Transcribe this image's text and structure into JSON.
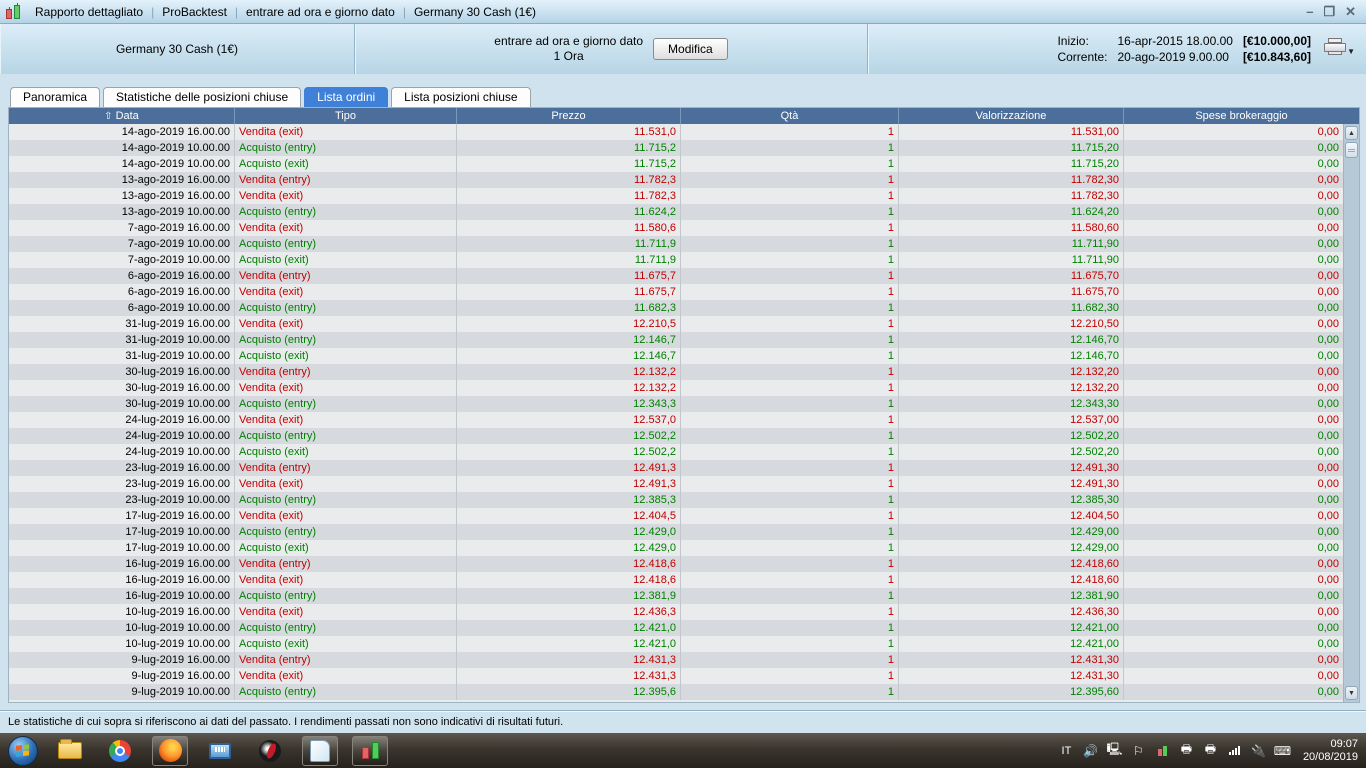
{
  "titlebar": {
    "segments": [
      "Rapporto dettagliato",
      "ProBacktest",
      "entrare ad ora e giorno dato",
      "Germany 30 Cash (1€)"
    ],
    "controls": {
      "minimize": "–",
      "restore": "❐",
      "close": "✕"
    }
  },
  "header": {
    "instrument": "Germany 30 Cash (1€)",
    "strategy": "entrare ad ora e giorno dato",
    "timeframe": "1 Ora",
    "modify_button": "Modifica",
    "start_label": "Inizio:",
    "start_date": "16-apr-2015 18.00.00",
    "start_amount": "[€10.000,00]",
    "current_label": "Corrente:",
    "current_date": "20-ago-2019 9.00.00",
    "current_amount": "[€10.843,60]"
  },
  "tabs": {
    "items": [
      {
        "label": "Panoramica",
        "active": false
      },
      {
        "label": "Statistiche delle posizioni chiuse",
        "active": false
      },
      {
        "label": "Lista ordini",
        "active": true
      },
      {
        "label": "Lista posizioni chiuse",
        "active": false
      }
    ]
  },
  "table": {
    "sort_arrow": "⇧",
    "columns": [
      "Data",
      "Tipo",
      "Prezzo",
      "Qtà",
      "Valorizzazione",
      "Spese brokeraggio"
    ],
    "colors": {
      "sell": "#c00000",
      "buy": "#008000",
      "header_bg": "#4b6f9a"
    },
    "rows": [
      {
        "date": "14-ago-2019 16.00.00",
        "type": "Vendita (exit)",
        "side": "sell",
        "price": "11.531,0",
        "qty": "1",
        "valuation": "11.531,00",
        "fees": "0,00"
      },
      {
        "date": "14-ago-2019 10.00.00",
        "type": "Acquisto (entry)",
        "side": "buy",
        "price": "11.715,2",
        "qty": "1",
        "valuation": "11.715,20",
        "fees": "0,00"
      },
      {
        "date": "14-ago-2019 10.00.00",
        "type": "Acquisto (exit)",
        "side": "buy",
        "price": "11.715,2",
        "qty": "1",
        "valuation": "11.715,20",
        "fees": "0,00"
      },
      {
        "date": "13-ago-2019 16.00.00",
        "type": "Vendita (entry)",
        "side": "sell",
        "price": "11.782,3",
        "qty": "1",
        "valuation": "11.782,30",
        "fees": "0,00"
      },
      {
        "date": "13-ago-2019 16.00.00",
        "type": "Vendita (exit)",
        "side": "sell",
        "price": "11.782,3",
        "qty": "1",
        "valuation": "11.782,30",
        "fees": "0,00"
      },
      {
        "date": "13-ago-2019 10.00.00",
        "type": "Acquisto (entry)",
        "side": "buy",
        "price": "11.624,2",
        "qty": "1",
        "valuation": "11.624,20",
        "fees": "0,00"
      },
      {
        "date": "7-ago-2019 16.00.00",
        "type": "Vendita (exit)",
        "side": "sell",
        "price": "11.580,6",
        "qty": "1",
        "valuation": "11.580,60",
        "fees": "0,00"
      },
      {
        "date": "7-ago-2019 10.00.00",
        "type": "Acquisto (entry)",
        "side": "buy",
        "price": "11.711,9",
        "qty": "1",
        "valuation": "11.711,90",
        "fees": "0,00"
      },
      {
        "date": "7-ago-2019 10.00.00",
        "type": "Acquisto (exit)",
        "side": "buy",
        "price": "11.711,9",
        "qty": "1",
        "valuation": "11.711,90",
        "fees": "0,00"
      },
      {
        "date": "6-ago-2019 16.00.00",
        "type": "Vendita (entry)",
        "side": "sell",
        "price": "11.675,7",
        "qty": "1",
        "valuation": "11.675,70",
        "fees": "0,00"
      },
      {
        "date": "6-ago-2019 16.00.00",
        "type": "Vendita (exit)",
        "side": "sell",
        "price": "11.675,7",
        "qty": "1",
        "valuation": "11.675,70",
        "fees": "0,00"
      },
      {
        "date": "6-ago-2019 10.00.00",
        "type": "Acquisto (entry)",
        "side": "buy",
        "price": "11.682,3",
        "qty": "1",
        "valuation": "11.682,30",
        "fees": "0,00"
      },
      {
        "date": "31-lug-2019 16.00.00",
        "type": "Vendita (exit)",
        "side": "sell",
        "price": "12.210,5",
        "qty": "1",
        "valuation": "12.210,50",
        "fees": "0,00"
      },
      {
        "date": "31-lug-2019 10.00.00",
        "type": "Acquisto (entry)",
        "side": "buy",
        "price": "12.146,7",
        "qty": "1",
        "valuation": "12.146,70",
        "fees": "0,00"
      },
      {
        "date": "31-lug-2019 10.00.00",
        "type": "Acquisto (exit)",
        "side": "buy",
        "price": "12.146,7",
        "qty": "1",
        "valuation": "12.146,70",
        "fees": "0,00"
      },
      {
        "date": "30-lug-2019 16.00.00",
        "type": "Vendita (entry)",
        "side": "sell",
        "price": "12.132,2",
        "qty": "1",
        "valuation": "12.132,20",
        "fees": "0,00"
      },
      {
        "date": "30-lug-2019 16.00.00",
        "type": "Vendita (exit)",
        "side": "sell",
        "price": "12.132,2",
        "qty": "1",
        "valuation": "12.132,20",
        "fees": "0,00"
      },
      {
        "date": "30-lug-2019 10.00.00",
        "type": "Acquisto (entry)",
        "side": "buy",
        "price": "12.343,3",
        "qty": "1",
        "valuation": "12.343,30",
        "fees": "0,00"
      },
      {
        "date": "24-lug-2019 16.00.00",
        "type": "Vendita (exit)",
        "side": "sell",
        "price": "12.537,0",
        "qty": "1",
        "valuation": "12.537,00",
        "fees": "0,00"
      },
      {
        "date": "24-lug-2019 10.00.00",
        "type": "Acquisto (entry)",
        "side": "buy",
        "price": "12.502,2",
        "qty": "1",
        "valuation": "12.502,20",
        "fees": "0,00"
      },
      {
        "date": "24-lug-2019 10.00.00",
        "type": "Acquisto (exit)",
        "side": "buy",
        "price": "12.502,2",
        "qty": "1",
        "valuation": "12.502,20",
        "fees": "0,00"
      },
      {
        "date": "23-lug-2019 16.00.00",
        "type": "Vendita (entry)",
        "side": "sell",
        "price": "12.491,3",
        "qty": "1",
        "valuation": "12.491,30",
        "fees": "0,00"
      },
      {
        "date": "23-lug-2019 16.00.00",
        "type": "Vendita (exit)",
        "side": "sell",
        "price": "12.491,3",
        "qty": "1",
        "valuation": "12.491,30",
        "fees": "0,00"
      },
      {
        "date": "23-lug-2019 10.00.00",
        "type": "Acquisto (entry)",
        "side": "buy",
        "price": "12.385,3",
        "qty": "1",
        "valuation": "12.385,30",
        "fees": "0,00"
      },
      {
        "date": "17-lug-2019 16.00.00",
        "type": "Vendita (exit)",
        "side": "sell",
        "price": "12.404,5",
        "qty": "1",
        "valuation": "12.404,50",
        "fees": "0,00"
      },
      {
        "date": "17-lug-2019 10.00.00",
        "type": "Acquisto (entry)",
        "side": "buy",
        "price": "12.429,0",
        "qty": "1",
        "valuation": "12.429,00",
        "fees": "0,00"
      },
      {
        "date": "17-lug-2019 10.00.00",
        "type": "Acquisto (exit)",
        "side": "buy",
        "price": "12.429,0",
        "qty": "1",
        "valuation": "12.429,00",
        "fees": "0,00"
      },
      {
        "date": "16-lug-2019 16.00.00",
        "type": "Vendita (entry)",
        "side": "sell",
        "price": "12.418,6",
        "qty": "1",
        "valuation": "12.418,60",
        "fees": "0,00"
      },
      {
        "date": "16-lug-2019 16.00.00",
        "type": "Vendita (exit)",
        "side": "sell",
        "price": "12.418,6",
        "qty": "1",
        "valuation": "12.418,60",
        "fees": "0,00"
      },
      {
        "date": "16-lug-2019 10.00.00",
        "type": "Acquisto (entry)",
        "side": "buy",
        "price": "12.381,9",
        "qty": "1",
        "valuation": "12.381,90",
        "fees": "0,00"
      },
      {
        "date": "10-lug-2019 16.00.00",
        "type": "Vendita (exit)",
        "side": "sell",
        "price": "12.436,3",
        "qty": "1",
        "valuation": "12.436,30",
        "fees": "0,00"
      },
      {
        "date": "10-lug-2019 10.00.00",
        "type": "Acquisto (entry)",
        "side": "buy",
        "price": "12.421,0",
        "qty": "1",
        "valuation": "12.421,00",
        "fees": "0,00"
      },
      {
        "date": "10-lug-2019 10.00.00",
        "type": "Acquisto (exit)",
        "side": "buy",
        "price": "12.421,0",
        "qty": "1",
        "valuation": "12.421,00",
        "fees": "0,00"
      },
      {
        "date": "9-lug-2019 16.00.00",
        "type": "Vendita (entry)",
        "side": "sell",
        "price": "12.431,3",
        "qty": "1",
        "valuation": "12.431,30",
        "fees": "0,00"
      },
      {
        "date": "9-lug-2019 16.00.00",
        "type": "Vendita (exit)",
        "side": "sell",
        "price": "12.431,3",
        "qty": "1",
        "valuation": "12.431,30",
        "fees": "0,00"
      },
      {
        "date": "9-lug-2019 10.00.00",
        "type": "Acquisto (entry)",
        "side": "buy",
        "price": "12.395,6",
        "qty": "1",
        "valuation": "12.395,60",
        "fees": "0,00"
      }
    ]
  },
  "statusbar": {
    "text": "Le statistiche di cui sopra si riferiscono ai dati del passato. I rendimenti passati non sono indicativi di risultati futuri."
  },
  "taskbar": {
    "tray_language": "IT",
    "clock_time": "09:07",
    "clock_date": "20/08/2019"
  }
}
